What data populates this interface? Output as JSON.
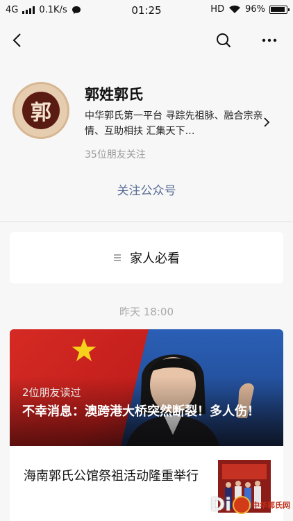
{
  "status_bar": {
    "network": "4G",
    "speed": "0.1K/s",
    "time": "01:25",
    "hd": "HD",
    "battery": "96%",
    "battery_level": 0.96
  },
  "nav": {
    "back_icon": "chevron-left-icon",
    "search_icon": "search-icon",
    "more_icon": "more-icon"
  },
  "account": {
    "avatar_char": "郭",
    "name": "郭姓郭氏",
    "description": "中华郭氏第一平台 寻踪先祖脉、融合宗亲情、互助相扶 汇集天下…",
    "followers": "35位朋友关注",
    "follow_label": "关注公众号"
  },
  "menu": {
    "label": "家人必看",
    "icon": "menu-icon"
  },
  "feed": {
    "date": "昨天 18:00",
    "main_article": {
      "read_by": "2位朋友读过",
      "title": "不幸消息：澳跨港大桥突然断裂！多人伤！"
    },
    "second_article": {
      "title": "海南郭氏公馆祭祖活动隆重举行"
    }
  },
  "watermark": {
    "text": "Di",
    "site": "中华郭氏网"
  },
  "colors": {
    "link": "#576b95",
    "background": "#f7f7f7",
    "muted": "#a8a8a8"
  }
}
